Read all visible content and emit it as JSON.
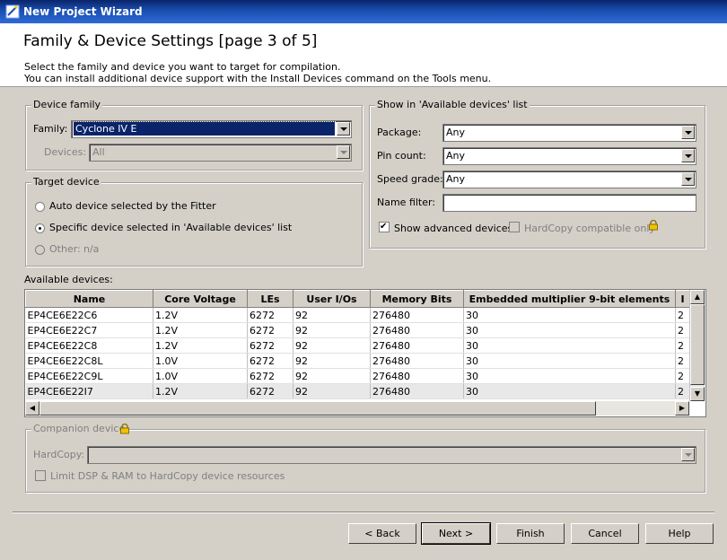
{
  "window": {
    "title": "New Project Wizard"
  },
  "header": {
    "title": "Family & Device Settings [page 3 of 5]",
    "line1": "Select the family and device you want to target for compilation.",
    "line2": "You can install additional device support with the Install Devices command on the Tools menu."
  },
  "device_family": {
    "group_label": "Device family",
    "family_label": "Family:",
    "family_value": "Cyclone IV E",
    "devices_label": "Devices:",
    "devices_value": "All"
  },
  "target_device": {
    "group_label": "Target device",
    "auto_label": "Auto device selected by the Fitter",
    "specific_label": "Specific device selected in 'Available devices' list",
    "other_label": "Other:",
    "other_value": "n/a"
  },
  "show_in": {
    "group_label": "Show in 'Available devices' list",
    "package_label": "Package:",
    "package_value": "Any",
    "pin_count_label": "Pin count:",
    "pin_count_value": "Any",
    "speed_grade_label": "Speed grade:",
    "speed_grade_value": "Any",
    "name_filter_label": "Name filter:",
    "name_filter_value": "",
    "show_advanced_label": "Show advanced devices",
    "show_advanced_checked": true,
    "hardcopy_label": "HardCopy compatible only",
    "hardcopy_checked": false
  },
  "available_devices": {
    "label": "Available devices:",
    "columns": [
      "Name",
      "Core Voltage",
      "LEs",
      "User I/Os",
      "Memory Bits",
      "Embedded multiplier 9-bit elements",
      "I"
    ],
    "rows": [
      [
        "EP4CE6E22C6",
        "1.2V",
        "6272",
        "92",
        "276480",
        "30",
        "2"
      ],
      [
        "EP4CE6E22C7",
        "1.2V",
        "6272",
        "92",
        "276480",
        "30",
        "2"
      ],
      [
        "EP4CE6E22C8",
        "1.2V",
        "6272",
        "92",
        "276480",
        "30",
        "2"
      ],
      [
        "EP4CE6E22C8L",
        "1.0V",
        "6272",
        "92",
        "276480",
        "30",
        "2"
      ],
      [
        "EP4CE6E22C9L",
        "1.0V",
        "6272",
        "92",
        "276480",
        "30",
        "2"
      ],
      [
        "EP4CE6E22I7",
        "1.2V",
        "6272",
        "92",
        "276480",
        "30",
        "2"
      ]
    ]
  },
  "companion": {
    "group_label": "Companion device",
    "hardcopy_label": "HardCopy:",
    "hardcopy_value": "",
    "limit_label": "Limit DSP & RAM to HardCopy device resources"
  },
  "buttons": {
    "back": "< Back",
    "next": "Next >",
    "finish": "Finish",
    "cancel": "Cancel",
    "help": "Help"
  },
  "colors": {
    "selection": "#0a246a",
    "title_gradient_start": "#0a246a",
    "title_gradient_end": "#2e6ad6",
    "face": "#d4d0c8"
  }
}
